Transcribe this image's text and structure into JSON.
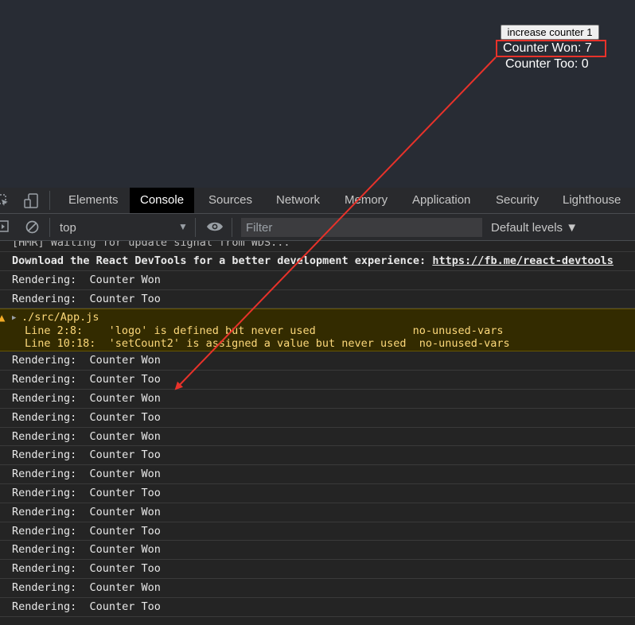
{
  "app": {
    "button_label": "increase counter 1",
    "counter_won": "Counter Won: 7",
    "counter_too": "Counter Too: 0"
  },
  "devtools": {
    "tabs": [
      {
        "label": "Elements"
      },
      {
        "label": "Console"
      },
      {
        "label": "Sources"
      },
      {
        "label": "Network"
      },
      {
        "label": "Memory"
      },
      {
        "label": "Application"
      },
      {
        "label": "Security"
      },
      {
        "label": "Lighthouse"
      }
    ],
    "active_tab": "Console",
    "toolbar": {
      "context": "top",
      "filter_placeholder": "Filter",
      "levels": "Default levels ▼"
    }
  },
  "console": {
    "hmr_line": "[HMR] Waiting for update signal from WDS...",
    "devtools_msg": "Download the React DevTools for a better development experience: ",
    "devtools_link": "https://fb.me/react-devtools",
    "pre_rows": [
      "Rendering:  Counter Won",
      "Rendering:  Counter Too"
    ],
    "warning": {
      "file": "./src/App.js",
      "line1": "Line 2:8:    'logo' is defined but never used               no-unused-vars",
      "line2": "Line 10:18:  'setCount2' is assigned a value but never used  no-unused-vars"
    },
    "post_rows": [
      "Rendering:  Counter Won",
      "Rendering:  Counter Too",
      "Rendering:  Counter Won",
      "Rendering:  Counter Too",
      "Rendering:  Counter Won",
      "Rendering:  Counter Too",
      "Rendering:  Counter Won",
      "Rendering:  Counter Too",
      "Rendering:  Counter Won",
      "Rendering:  Counter Too",
      "Rendering:  Counter Won",
      "Rendering:  Counter Too",
      "Rendering:  Counter Won",
      "Rendering:  Counter Too"
    ]
  },
  "annotation": {
    "color": "#e8322a"
  }
}
